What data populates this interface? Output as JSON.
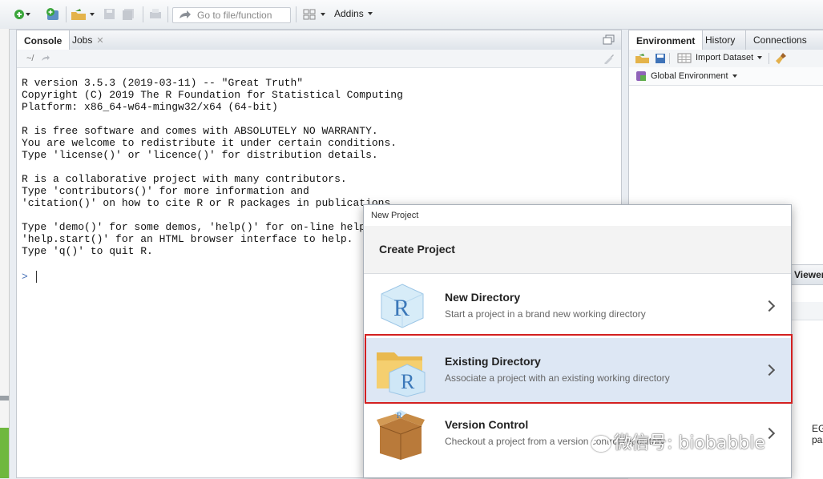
{
  "toolbar": {
    "goto_placeholder": "Go to file/function",
    "addins_label": "Addins"
  },
  "console_pane": {
    "tabs": [
      {
        "label": "Console"
      },
      {
        "label": "Jobs"
      }
    ],
    "path": "~/",
    "output_lines": [
      "R version 3.5.3 (2019-03-11) -- \"Great Truth\"",
      "Copyright (C) 2019 The R Foundation for Statistical Computing",
      "Platform: x86_64-w64-mingw32/x64 (64-bit)",
      "",
      "R is free software and comes with ABSOLUTELY NO WARRANTY.",
      "You are welcome to redistribute it under certain conditions.",
      "Type 'license()' or 'licence()' for distribution details.",
      "",
      "R is a collaborative project with many contributors.",
      "Type 'contributors()' for more information and",
      "'citation()' on how to cite R or R packages in publications.",
      "",
      "Type 'demo()' for some demos, 'help()' for on-line help, or",
      "'help.start()' for an HTML browser interface to help.",
      "Type 'q()' to quit R."
    ],
    "prompt": ">"
  },
  "env_pane": {
    "tabs": [
      {
        "label": "Environment"
      },
      {
        "label": "History"
      },
      {
        "label": "Connections"
      }
    ],
    "import_dataset": "Import Dataset",
    "global_env": "Global Environment"
  },
  "files_pane": {
    "viewer_tab": "Viewer",
    "partial_text": "EGG pa"
  },
  "dialog": {
    "window_title": "New Project",
    "heading": "Create Project",
    "options": [
      {
        "title": "New Directory",
        "description": "Start a project in a brand new working directory"
      },
      {
        "title": "Existing Directory",
        "description": "Associate a project with an existing working directory"
      },
      {
        "title": "Version Control",
        "description": "Checkout a project from a version control repository"
      }
    ]
  },
  "watermark": "微信号: biobabble",
  "colors": {
    "selected_option_bg": "#dde7f4",
    "highlight_border": "#d32020",
    "prompt_color": "#4a73b8"
  }
}
